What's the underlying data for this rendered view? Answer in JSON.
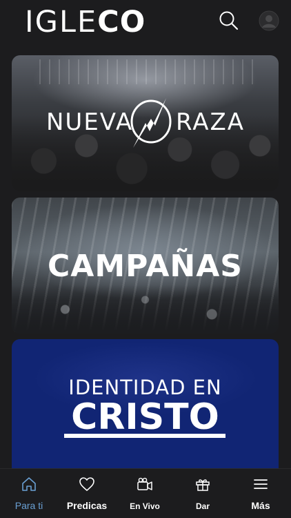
{
  "header": {
    "logo_light": "IGLE",
    "logo_bold": "CO",
    "search_icon": "search-icon",
    "avatar_icon": "user-avatar-icon"
  },
  "cards": [
    {
      "left": "NUEVA",
      "right": "RAZA",
      "logo": "lightning-n-logo"
    },
    {
      "title": "CAMPAÑAS"
    },
    {
      "line1": "IDENTIDAD EN",
      "line2": "CRISTO"
    }
  ],
  "tabs": [
    {
      "label": "Para ti",
      "icon": "home-icon",
      "active": true
    },
    {
      "label": "Predicas",
      "icon": "heart-icon"
    },
    {
      "label": "En Vivo",
      "icon": "video-camera-icon"
    },
    {
      "label": "Dar",
      "icon": "gift-icon"
    },
    {
      "label": "Más",
      "icon": "menu-icon"
    }
  ],
  "colors": {
    "background": "#1c1c1e",
    "active_tab": "#6aa0d4",
    "card3_blue": "#112574"
  }
}
